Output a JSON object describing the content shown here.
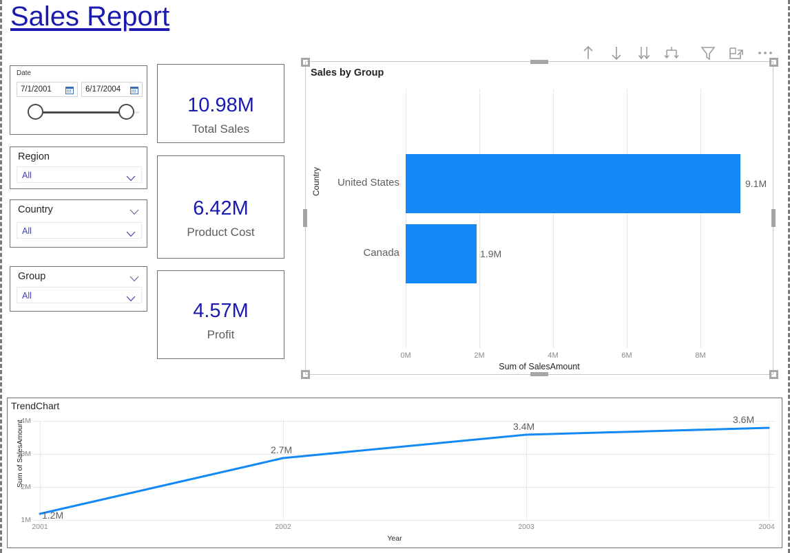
{
  "page": {
    "title": "Sales Report",
    "title_color": "#1a1aae"
  },
  "slicers": {
    "date": {
      "label": "Date",
      "start_value": "7/1/2001",
      "end_value": "6/17/2004",
      "start_icon": "calendar-icon",
      "end_icon": "calendar-icon"
    },
    "region": {
      "label": "Region",
      "selected": "All",
      "chevron_icon": "chevron-down-icon"
    },
    "country": {
      "label": "Country",
      "selected": "All",
      "chevron_icon": "chevron-down-icon"
    },
    "group": {
      "label": "Group",
      "selected": "All",
      "chevron_icon": "chevron-down-icon"
    }
  },
  "kpis": [
    {
      "value": "10.98M",
      "label": "Total Sales"
    },
    {
      "value": "6.42M",
      "label": "Product Cost"
    },
    {
      "value": "4.57M",
      "label": "Profit"
    }
  ],
  "toolbar": {
    "icons": [
      "drill-up-arrow-icon",
      "drill-down-arrow-icon",
      "expand-next-level-icon",
      "expand-all-hierarchy-icon",
      "filter-funnel-icon",
      "focus-mode-icon",
      "more-options-ellipsis-icon"
    ]
  },
  "chart_data": [
    {
      "type": "bar",
      "title": "Sales by Group",
      "orientation": "horizontal",
      "categories": [
        "United States",
        "Canada"
      ],
      "values": [
        9.1,
        1.9
      ],
      "data_labels": [
        "9.1M",
        "1.9M"
      ],
      "xlabel": "Sum of SalesAmount",
      "ylabel": "Country",
      "xticks": [
        "0M",
        "2M",
        "4M",
        "6M",
        "8M"
      ],
      "xtick_values": [
        0,
        2,
        4,
        6,
        8
      ],
      "xlim": [
        0,
        9.6
      ],
      "grid": true,
      "legend": "none",
      "series_color": "#1289f5"
    },
    {
      "type": "line",
      "title": "TrendChart",
      "x": [
        "2001",
        "2002",
        "2003",
        "2004"
      ],
      "values": [
        1.2,
        2.7,
        3.4,
        3.6
      ],
      "data_labels": [
        "1.2M",
        "2.7M",
        "3.4M",
        "3.6M"
      ],
      "xlabel": "Year",
      "ylabel": "Sum of SalesAmount",
      "yticks": [
        "1M",
        "2M",
        "3M",
        "4M"
      ],
      "ytick_values": [
        1,
        2,
        3,
        4
      ],
      "ylim": [
        1,
        4
      ],
      "grid": true,
      "legend": "none",
      "series_color": "#1289f5"
    }
  ]
}
